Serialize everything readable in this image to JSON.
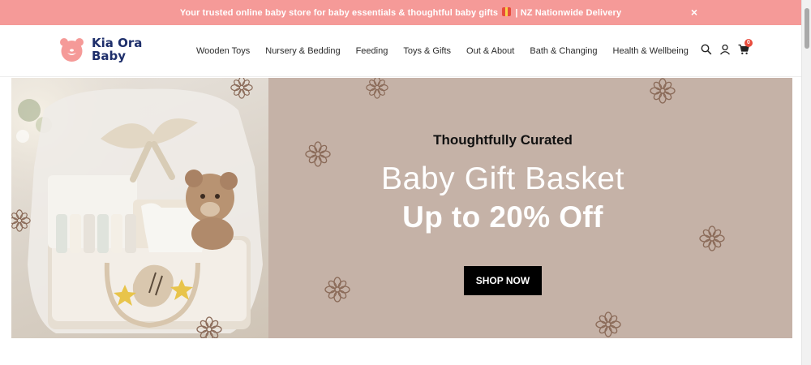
{
  "announcement": {
    "text_before": "Your trusted online baby store for baby essentials & thoughtful baby gifts",
    "text_after": "| NZ Nationwide Delivery",
    "close_label": "×"
  },
  "brand": {
    "name_line1": "Kia Ora",
    "name_line2": "Baby",
    "logo_color": "#f59a98",
    "text_color": "#1e2f6b"
  },
  "nav": {
    "items": [
      {
        "label": "Wooden Toys"
      },
      {
        "label": "Nursery & Bedding"
      },
      {
        "label": "Feeding"
      },
      {
        "label": "Toys & Gifts"
      },
      {
        "label": "Out & About"
      },
      {
        "label": "Bath & Changing"
      },
      {
        "label": "Health & Wellbeing"
      }
    ]
  },
  "header_icons": {
    "search": "search-icon",
    "account": "user-icon",
    "cart": "cart-icon",
    "cart_count": "0"
  },
  "hero": {
    "eyebrow": "Thoughtfully Curated",
    "headline": "Baby Gift Basket",
    "subline": "Up to 20% Off",
    "cta_label": "SHOP NOW",
    "background": "#c5b2a7"
  }
}
